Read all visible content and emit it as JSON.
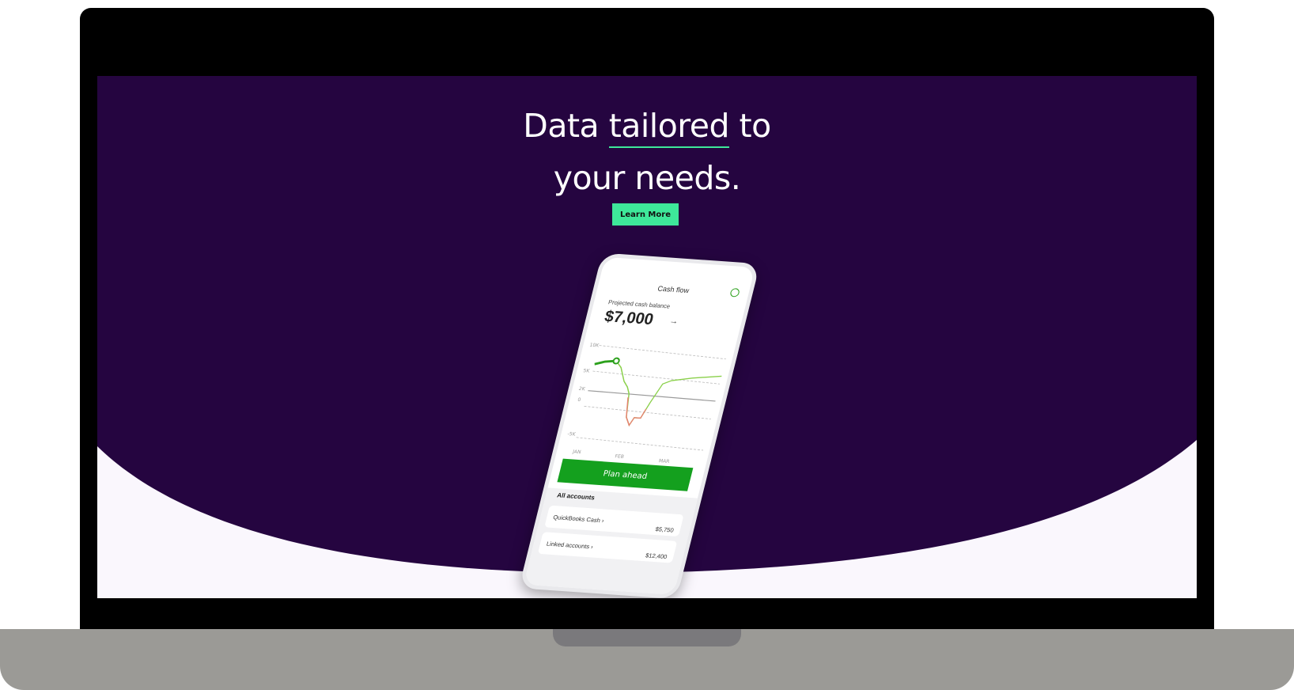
{
  "hero": {
    "headline_pre": "Data ",
    "headline_underlined": "tailored",
    "headline_post": " to",
    "headline_line2": "your needs.",
    "cta_label": "Learn More"
  },
  "phone": {
    "title": "Cash flow",
    "subtitle": "Projected cash balance",
    "amount": "$7,000",
    "amount_arrow": "→",
    "y_ticks": [
      "10K",
      "5K",
      "2K",
      "0",
      "-5K"
    ],
    "x_ticks": [
      "JAN",
      "FEB",
      "MAR"
    ],
    "plan_button": "Plan ahead",
    "accounts_title": "All accounts",
    "accounts": [
      {
        "name": "QuickBooks Cash  ›",
        "value": "$5,750"
      },
      {
        "name": "Linked accounts  ›",
        "value": "$12,400"
      }
    ]
  },
  "colors": {
    "hero_bg": "#250540",
    "accent": "#3ee89a",
    "chart_green": "#2ca01c",
    "button_green": "#14a01e",
    "screen_bg": "#faf7fd"
  },
  "icons": [
    "chat-icon",
    "arrow-right-icon",
    "chevron-right-icon"
  ]
}
